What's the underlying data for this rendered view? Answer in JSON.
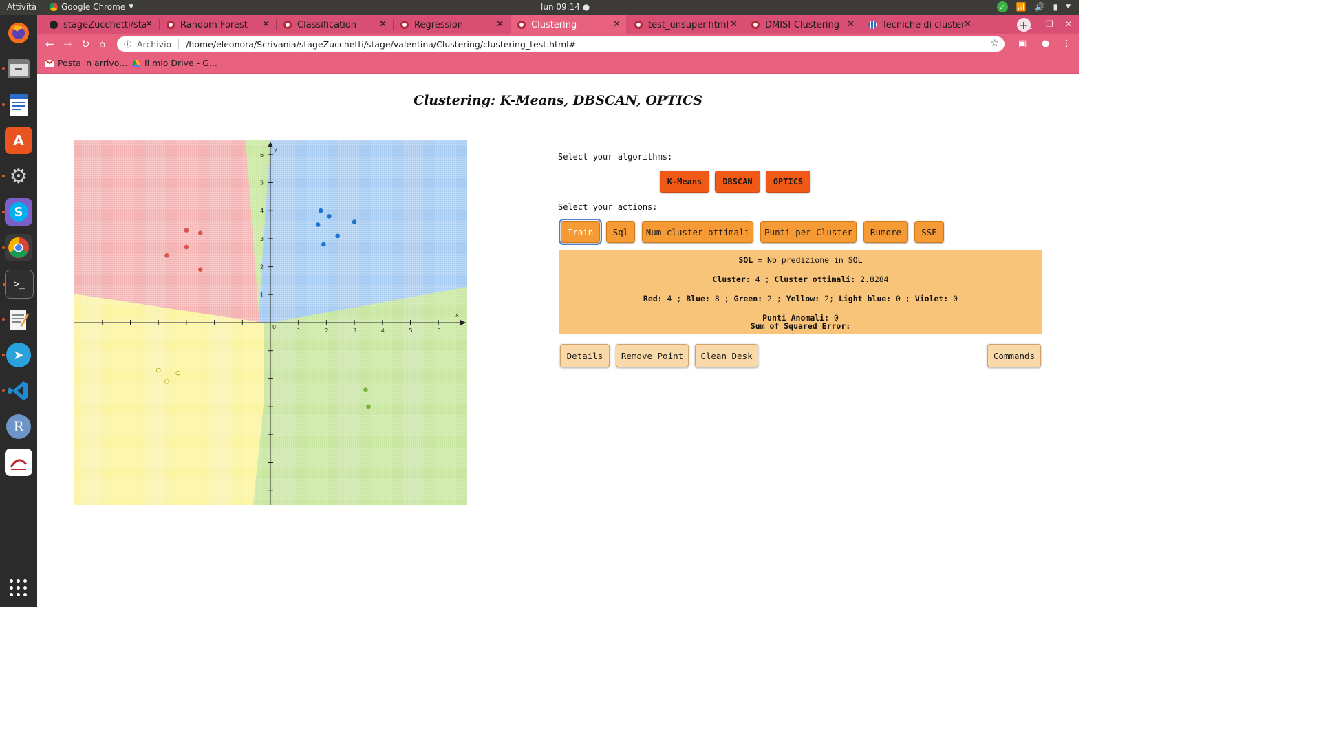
{
  "os": {
    "activities": "Attività",
    "app_name": "Google Chrome",
    "clock": "lun 09:14"
  },
  "browser": {
    "tabs": [
      {
        "label": "stageZucchetti/stage",
        "icon": "github-icon"
      },
      {
        "label": "Random Forest",
        "icon": "page-icon"
      },
      {
        "label": "Classification",
        "icon": "page-icon"
      },
      {
        "label": "Regression",
        "icon": "page-icon"
      },
      {
        "label": "Clustering",
        "icon": "page-icon",
        "active": true
      },
      {
        "label": "test_unsuper.html",
        "icon": "page-icon"
      },
      {
        "label": "DMISI-Clustering",
        "icon": "page-icon"
      },
      {
        "label": "Tecniche di clustering",
        "icon": "grid-icon"
      }
    ],
    "omnibox": {
      "scheme_label": "Archivio",
      "url": "/home/eleonora/Scrivania/stageZucchetti/stage/valentina/Clustering/clustering_test.html#"
    },
    "bookmarks": [
      {
        "label": "Posta in arrivo...",
        "icon": "gmail-icon"
      },
      {
        "label": "Il mio Drive - G...",
        "icon": "drive-icon"
      }
    ]
  },
  "page": {
    "title": "Clustering: K-Means, DBSCAN, OPTICS",
    "algorithms_label": "Select your algorithms:",
    "algorithms": [
      "K-Means",
      "DBSCAN",
      "OPTICS"
    ],
    "actions_label": "Select your actions:",
    "actions": [
      "Train",
      "Sql",
      "Num cluster ottimali",
      "Punti per Cluster",
      "Rumore",
      "SSE"
    ],
    "selected_action": "Train",
    "results": {
      "sql_label": "SQL =",
      "sql_value": "No predizione in SQL",
      "cluster_label": "Cluster:",
      "cluster_value": "4",
      "optimal_label": "Cluster ottimali:",
      "optimal_value": "2.8284",
      "counts": [
        {
          "label": "Red:",
          "value": "4"
        },
        {
          "label": "Blue:",
          "value": "8"
        },
        {
          "label": "Green:",
          "value": "2"
        },
        {
          "label": "Yellow:",
          "value": "2"
        },
        {
          "label": "Light blue:",
          "value": "0"
        },
        {
          "label": "Violet:",
          "value": "0"
        }
      ],
      "anomalies_label": "Punti Anomali:",
      "anomalies_value": "0",
      "sse_label": "Sum of Squared Error:",
      "sse_value": ""
    },
    "buttons": {
      "details": "Details",
      "remove_point": "Remove Point",
      "clean_desk": "Clean Desk",
      "commands": "Commands"
    }
  },
  "plot": {
    "axis_labels": {
      "x": "x",
      "y": "y",
      "origin": "0"
    },
    "x_ticks": [
      "1",
      "2",
      "3",
      "4",
      "5",
      "6"
    ],
    "y_ticks": [
      "1",
      "2",
      "3",
      "4",
      "5",
      "6"
    ],
    "region_colors": {
      "red": "#f4b4b4",
      "blue": "#a9cdf2",
      "yellow": "#fbf4a4",
      "green": "#c9e6a3"
    },
    "clusters": [
      {
        "name": "red",
        "color": "#d9544f",
        "points": [
          [
            -3,
            3.3
          ],
          [
            -2.5,
            3.2
          ],
          [
            -3,
            2.7
          ],
          [
            -3.7,
            2.4
          ],
          [
            -2.5,
            1.9
          ]
        ]
      },
      {
        "name": "blue",
        "color": "#1f74d1",
        "points": [
          [
            1.8,
            4.0
          ],
          [
            2.1,
            3.8
          ],
          [
            1.7,
            3.5
          ],
          [
            3.0,
            3.6
          ],
          [
            2.4,
            3.1
          ],
          [
            1.9,
            2.8
          ]
        ]
      },
      {
        "name": "yellow",
        "color": "#e2d845",
        "points": [
          [
            -4.0,
            -1.7
          ],
          [
            -3.3,
            -1.8
          ],
          [
            -3.7,
            -2.1
          ]
        ]
      },
      {
        "name": "green",
        "color": "#76b23a",
        "points": [
          [
            3.4,
            -2.4
          ],
          [
            3.5,
            -3.0
          ]
        ]
      }
    ]
  }
}
